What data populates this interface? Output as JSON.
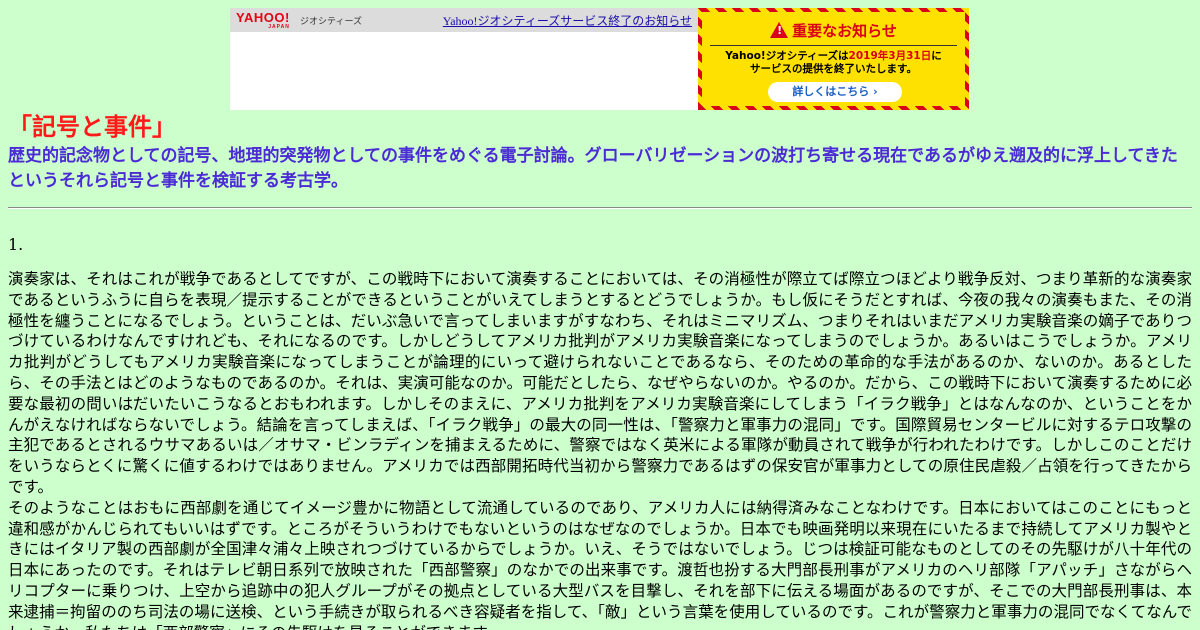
{
  "banner": {
    "logo_text": "YAHOO!",
    "logo_sub": "JAPAN",
    "geo_label": "ジオシティーズ",
    "end_notice_link": "Yahoo!ジオシティーズサービス終了のお知らせ",
    "notice_title": "重要なお知らせ",
    "notice_line1_prefix": "Yahoo!ジオシティーズは",
    "notice_line1_date": "2019年3月31日",
    "notice_line1_suffix": "に",
    "notice_line2": "サービスの提供を終了いたします。",
    "details_button": "詳しくはこちら ›",
    "colors": {
      "accent_red": "#d9001b",
      "notice_yellow": "#ffe100",
      "link_blue": "#1a0dab"
    }
  },
  "page": {
    "title": "「記号と事件」",
    "subtitle": "歴史的記念物としての記号、地理的突発物としての事件をめぐる電子討論。グローバリゼーションの波打ち寄せる現在であるがゆえ遡及的に浮上してきたというそれら記号と事件を検証する考古学。",
    "section_number": "1.",
    "paragraph1": "演奏家は、それはこれが戦争であるとしてですが、この戦時下において演奏することにおいては、その消極性が際立てば際立つほどより戦争反対、つまり革新的な演奏家であるというふうに自らを表現／提示することができるということがいえてしまうとするとどうでしょうか。もし仮にそうだとすれば、今夜の我々の演奏もまた、その消極性を纏うことになるでしょう。ということは、だいぶ急いで言ってしまいますがすなわち、それはミニマリズム、つまりそれはいまだアメリカ実験音楽の嫡子でありつづけているわけなんですけれども、それになるのです。しかしどうしてアメリカ批判がアメリカ実験音楽になってしまうのでしょうか。あるいはこうでしょうか。アメリカ批判がどうしてもアメリカ実験音楽になってしまうことが論理的にいって避けられないことであるなら、そのための革命的な手法があるのか、ないのか。あるとしたら、その手法とはどのようなものであるのか。それは、実演可能なのか。可能だとしたら、なぜやらないのか。やるのか。だから、この戦時下において演奏するために必要な最初の問いはだいたいこうなるとおもわれます。しかしそのまえに、アメリカ批判をアメリカ実験音楽にしてしまう「イラク戦争」とはなんなのか、ということをかんがえなければならないでしょう。結論を言ってしまえば、「イラク戦争」の最大の同一性は、「警察力と軍事力の混同」です。国際貿易センタービルに対するテロ攻撃の主犯であるとされるウサマあるいは／オサマ・ビンラディンを捕まえるために、警察ではなく英米による軍隊が動員されて戦争が行われたわけです。しかしこのことだけをいうならとくに驚くに値するわけではありません。アメリカでは西部開拓時代当初から警察力であるはずの保安官が軍事力としての原住民虐殺／占領を行ってきたからです。",
    "paragraph2": "そのようなことはおもに西部劇を通じてイメージ豊かに物語として流通しているのであり、アメリカ人には納得済みなことなわけです。日本においてはこのことにもっと違和感がかんじられてもいいはずです。ところがそういうわけでもないというのはなぜなのでしょうか。日本でも映画発明以来現在にいたるまで持続してアメリカ製やときにはイタリア製の西部劇が全国津々浦々上映されつづけているからでしょうか。いえ、そうではないでしょう。じつは検証可能なものとしてのその先駆けが八十年代の日本にあったのです。それはテレビ朝日系列で放映された「西部警察」のなかでの出来事です。渡哲也扮する大門部長刑事がアメリカのヘリ部隊「アパッチ」さながらヘリコプターに乗りつけ、上空から追跡中の犯人グループがその拠点としている大型バスを目撃し、それを部下に伝える場面があるのですが、そこでの大門部長刑事は、本来逮捕＝拘留ののち司法の場に送検、という手続きが取られるべき容疑者を指して、「敵」という言葉を使用しているのです。これが警察力と軍事力の混同でなくてなんでしょうか。私たちは「西部警察」にその先駆けを見ることができます。"
  }
}
